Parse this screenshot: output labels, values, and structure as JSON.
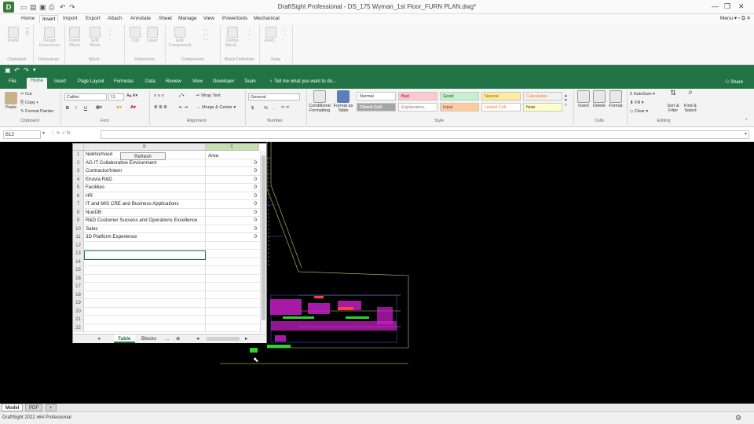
{
  "app": {
    "title": "DraftSight Professional - DS_175 Wyman_1st Floor_FURN PLAN.dwg*",
    "menu_label": "Menu",
    "tabs": [
      "Home",
      "Insert",
      "Import",
      "Export",
      "Attach",
      "Annotate",
      "Sheet",
      "Manage",
      "View",
      "Powertools",
      "Mechanical"
    ],
    "active_tab": "Insert"
  },
  "ds_ribbon": {
    "buttons": [
      "Paste",
      "Design Resources",
      "Insert Block",
      "Edit Block",
      "Clip",
      "Layer",
      "Edit Component",
      "Define Block...",
      "Field..."
    ],
    "groups": [
      "Clipboard",
      "Resources",
      "Block",
      "Reference",
      "Component",
      "Block Definition",
      "Data"
    ]
  },
  "excel": {
    "tabs": [
      "File",
      "Home",
      "Insert",
      "Page Layout",
      "Formulas",
      "Data",
      "Review",
      "View",
      "Developer",
      "Team"
    ],
    "active_tab": "Home",
    "tellme": "Tell me what you want to do...",
    "share": "Share",
    "clipboard": {
      "paste": "Paste",
      "cut": "Cut",
      "copy": "Copy",
      "format_painter": "Format Painter",
      "group": "Clipboard"
    },
    "font": {
      "name": "Calibri",
      "size": "11",
      "group": "Font",
      "bold": "B",
      "italic": "I",
      "underline": "U"
    },
    "alignment": {
      "wrap": "Wrap Text",
      "merge": "Merge & Center",
      "group": "Alignment"
    },
    "number": {
      "format": "General",
      "currency": "$",
      "percent": "%",
      "comma": ",",
      "group": "Number"
    },
    "styles": {
      "conditional": "Conditional Formatting",
      "format_table": "Format as Table",
      "cells": [
        "Normal",
        "Bad",
        "Good",
        "Neutral",
        "Calculation",
        "Check Cell",
        "Explanatory...",
        "Input",
        "Linked Cell",
        "Note"
      ],
      "group": "Style"
    },
    "cells": {
      "insert": "Insert",
      "delete": "Delete",
      "format": "Format",
      "group": "Cells"
    },
    "editing": {
      "autosum": "AutoSum",
      "fill": "Fill",
      "clear": "Clear",
      "sort": "Sort & Filter",
      "find": "Find & Select",
      "group": "Editing"
    },
    "namebox": "B13"
  },
  "sheet": {
    "col_headers": [
      "B",
      "C"
    ],
    "refresh_label": "Refresh",
    "header_c": "Area",
    "rows": [
      {
        "n": "1",
        "b": "Nebhorhood",
        "c": ""
      },
      {
        "n": "2",
        "b": "AG IT Collaborative Environment",
        "c": "0"
      },
      {
        "n": "3",
        "b": "Contractor/Intern",
        "c": "0"
      },
      {
        "n": "4",
        "b": "Enovia R&D",
        "c": "0"
      },
      {
        "n": "5",
        "b": "Facilities",
        "c": "0"
      },
      {
        "n": "6",
        "b": "HR",
        "c": "0"
      },
      {
        "n": "7",
        "b": "IT and MIS CRE and Business Applications",
        "c": "0"
      },
      {
        "n": "8",
        "b": "NuoDB",
        "c": "0"
      },
      {
        "n": "9",
        "b": "R&D Customer Success and Operations Excellence",
        "c": "0"
      },
      {
        "n": "10",
        "b": "Sales",
        "c": "0"
      },
      {
        "n": "11",
        "b": "3D Platform Experience",
        "c": "0"
      },
      {
        "n": "12",
        "b": "",
        "c": ""
      },
      {
        "n": "13",
        "b": "",
        "c": ""
      },
      {
        "n": "14",
        "b": "",
        "c": ""
      },
      {
        "n": "15",
        "b": "",
        "c": ""
      },
      {
        "n": "16",
        "b": "",
        "c": ""
      },
      {
        "n": "17",
        "b": "",
        "c": ""
      },
      {
        "n": "18",
        "b": "",
        "c": ""
      },
      {
        "n": "19",
        "b": "",
        "c": ""
      },
      {
        "n": "20",
        "b": "",
        "c": ""
      },
      {
        "n": "21",
        "b": "",
        "c": ""
      },
      {
        "n": "22",
        "b": "",
        "c": ""
      }
    ],
    "tabs": [
      "Table",
      "Blocks",
      "..."
    ],
    "active_tab": "Table"
  },
  "model_tabs": [
    "Model",
    "PDF"
  ],
  "status": {
    "text": "DraftSight 2022 x64 Professional"
  }
}
